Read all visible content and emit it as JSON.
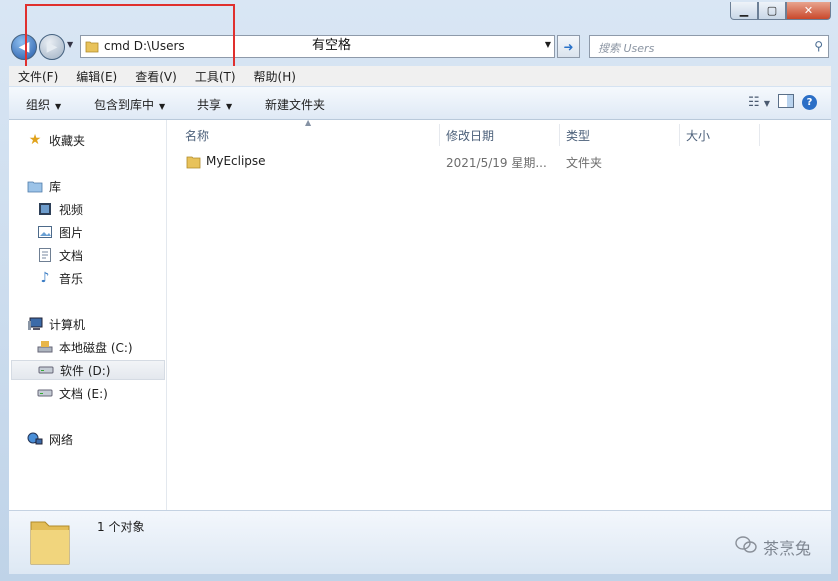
{
  "address": {
    "value": "cmd D:\\Users"
  },
  "annotation": {
    "text": "有空格"
  },
  "search": {
    "placeholder": "搜索 Users"
  },
  "menu": [
    "文件(F)",
    "编辑(E)",
    "查看(V)",
    "工具(T)",
    "帮助(H)"
  ],
  "toolbar": {
    "organize": "组织",
    "include": "包含到库中",
    "share": "共享",
    "new_folder": "新建文件夹"
  },
  "nav": {
    "favorites": "收藏夹",
    "libraries": "库",
    "videos": "视频",
    "pictures": "图片",
    "documents": "文档",
    "music": "音乐",
    "computer": "计算机",
    "drive_c": "本地磁盘 (C:)",
    "drive_d": "软件 (D:)",
    "drive_e": "文档 (E:)",
    "network": "网络"
  },
  "columns": {
    "name": "名称",
    "date": "修改日期",
    "type": "类型",
    "size": "大小"
  },
  "files": [
    {
      "name": "MyEclipse",
      "date": "2021/5/19 星期...",
      "type": "文件夹",
      "size": ""
    }
  ],
  "status": {
    "count": "1 个对象"
  },
  "watermark": {
    "text": "茶烹兔"
  }
}
